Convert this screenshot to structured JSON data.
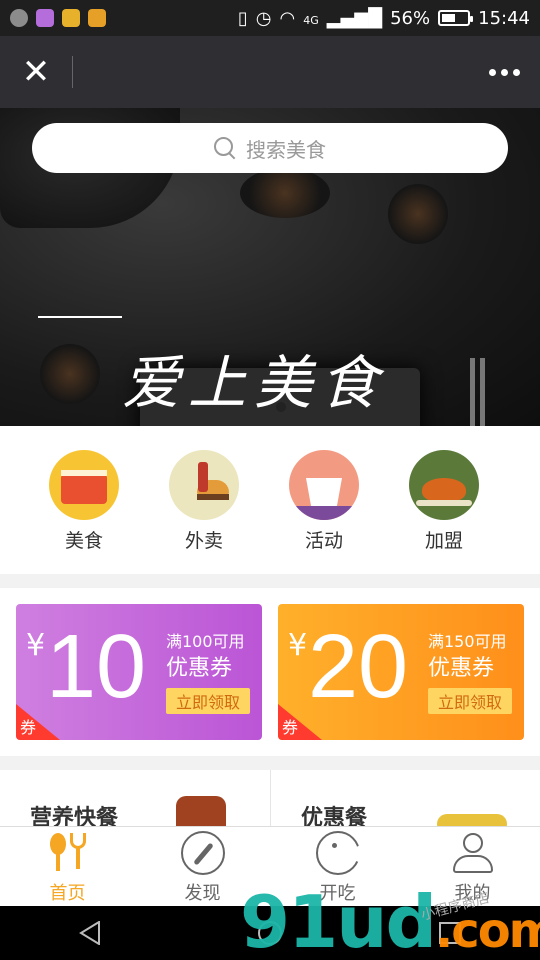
{
  "status_bar": {
    "network": "4G",
    "battery_percent": "56%",
    "battery_level": 0.56,
    "time": "15:44",
    "app_icon_colors": [
      "#8c8c8c",
      "#b66ddc",
      "#e7b12c",
      "#e6a028"
    ]
  },
  "header": {
    "close_icon": "close-icon",
    "more_icon": "more-dots-icon"
  },
  "banner": {
    "search_placeholder": "搜索美食",
    "title": "爱上美食"
  },
  "categories": [
    {
      "label": "美食",
      "icon": "cake-icon",
      "color": "#f7c533"
    },
    {
      "label": "外卖",
      "icon": "burger-icon",
      "color": "#ebe6be"
    },
    {
      "label": "活动",
      "icon": "noodle-box-icon",
      "color": "#f39a82"
    },
    {
      "label": "加盟",
      "icon": "roast-chicken-icon",
      "color": "#5b7a3a"
    }
  ],
  "coupons": [
    {
      "currency": "¥",
      "amount": "10",
      "condition": "满100可用",
      "kind": "优惠券",
      "claim": "立即领取",
      "tag": "券",
      "color": "#c76ad9"
    },
    {
      "currency": "¥",
      "amount": "20",
      "condition": "满150可用",
      "kind": "优惠券",
      "claim": "立即领取",
      "tag": "券",
      "color": "#ff9d22"
    }
  ],
  "combos": [
    {
      "label": "营养快餐"
    },
    {
      "label": "优惠餐"
    }
  ],
  "bottom_nav": [
    {
      "label": "首页",
      "icon": "spoon-fork-icon",
      "active": true
    },
    {
      "label": "发现",
      "icon": "compass-icon",
      "active": false
    },
    {
      "label": "开吃",
      "icon": "pacman-icon",
      "active": false
    },
    {
      "label": "我的",
      "icon": "user-icon",
      "active": false
    }
  ],
  "watermark": {
    "brand": "91ud",
    "tld": ".com",
    "sub": "小程序商店"
  }
}
